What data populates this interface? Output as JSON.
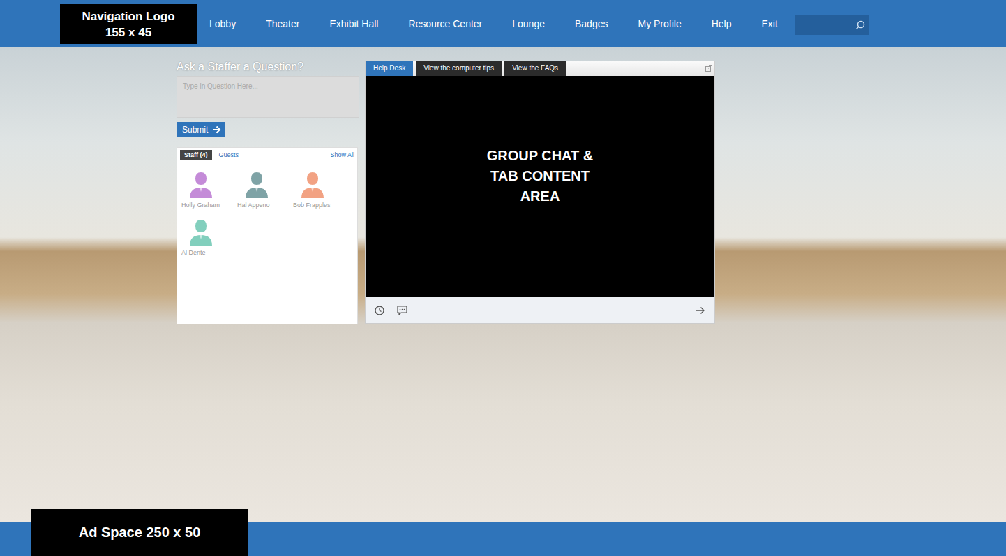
{
  "logo": {
    "lines": [
      "Navigation Logo",
      "155 x 45"
    ]
  },
  "nav": [
    {
      "label": "Lobby"
    },
    {
      "label": "Theater"
    },
    {
      "label": "Exhibit Hall"
    },
    {
      "label": "Resource Center"
    },
    {
      "label": "Lounge"
    },
    {
      "label": "Badges"
    },
    {
      "label": "My Profile"
    },
    {
      "label": "Help"
    },
    {
      "label": "Exit"
    }
  ],
  "question": {
    "title": "Ask a Staffer a Question?",
    "placeholder": "Type in Question Here...",
    "submit": "Submit"
  },
  "people": {
    "tabs": [
      {
        "label": "Staff (4)",
        "selected": true
      },
      {
        "label": "Guests",
        "selected": false
      }
    ],
    "show_all": "Show All",
    "items": [
      {
        "name": "Holly Graham",
        "color": "#c48bd8"
      },
      {
        "name": "Hal Appeno",
        "color": "#7fa3a6"
      },
      {
        "name": "Bob Frapples",
        "color": "#f2a283"
      },
      {
        "name": "Al Dente",
        "color": "#82cfbd"
      }
    ]
  },
  "content": {
    "tabs": [
      {
        "label": "Help Desk",
        "selected": true
      },
      {
        "label": "View the computer tips",
        "selected": false
      },
      {
        "label": "View the FAQs",
        "selected": false
      }
    ],
    "lines": [
      "GROUP CHAT &",
      "TAB CONTENT",
      "AREA"
    ]
  },
  "ad": {
    "label": "Ad Space 250 x 50"
  }
}
